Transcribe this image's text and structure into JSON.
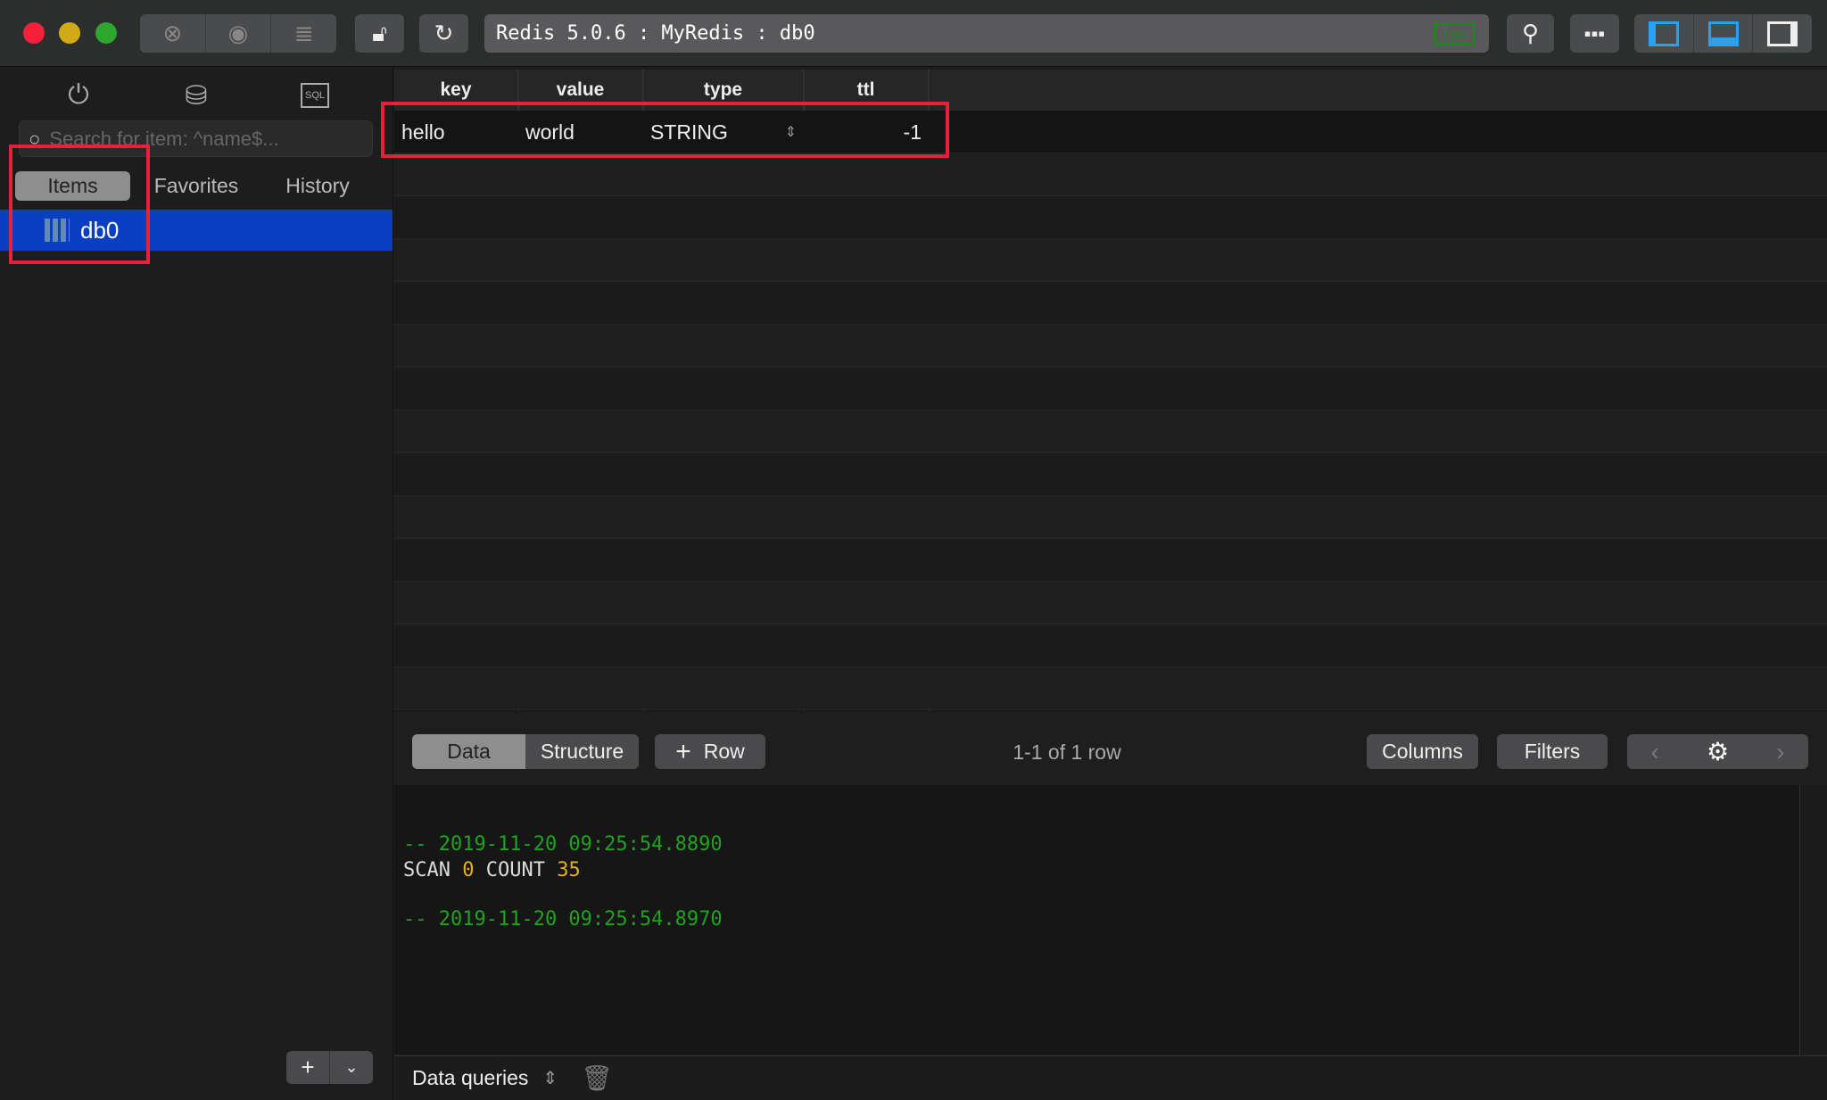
{
  "window": {
    "title": "Redis 5.0.6 : MyRedis : db0",
    "status_badge": "loc"
  },
  "colors": {
    "accent": "#0a3fc4",
    "highlight": "#e8203a",
    "comment": "#1ea31e",
    "number": "#e0b020"
  },
  "sidebar": {
    "search_placeholder": "Search for item: ^name$...",
    "tabs": [
      {
        "label": "Items",
        "active": true
      },
      {
        "label": "Favorites"
      },
      {
        "label": "History"
      }
    ],
    "items": [
      {
        "label": "db0",
        "selected": true
      }
    ],
    "sql_icon_label": "SQL"
  },
  "table": {
    "columns": [
      "key",
      "value",
      "type",
      "ttl"
    ],
    "rows": [
      {
        "key": "hello",
        "value": "world",
        "type": "STRING",
        "ttl": "-1"
      }
    ]
  },
  "toolbar": {
    "data_label": "Data",
    "structure_label": "Structure",
    "add_row_label": "Row",
    "row_count": "1-1 of 1 row",
    "columns_label": "Columns",
    "filters_label": "Filters"
  },
  "console": {
    "lines": [
      {
        "comment": "-- 2019-11-20 09:25:54.8890"
      },
      {
        "cmd": "SCAN",
        "arg1": "0",
        "kw": "COUNT",
        "arg2": "35"
      },
      {
        "comment": "-- 2019-11-20 09:25:54.8970"
      }
    ]
  },
  "bottombar": {
    "query_filter": "Data queries"
  }
}
